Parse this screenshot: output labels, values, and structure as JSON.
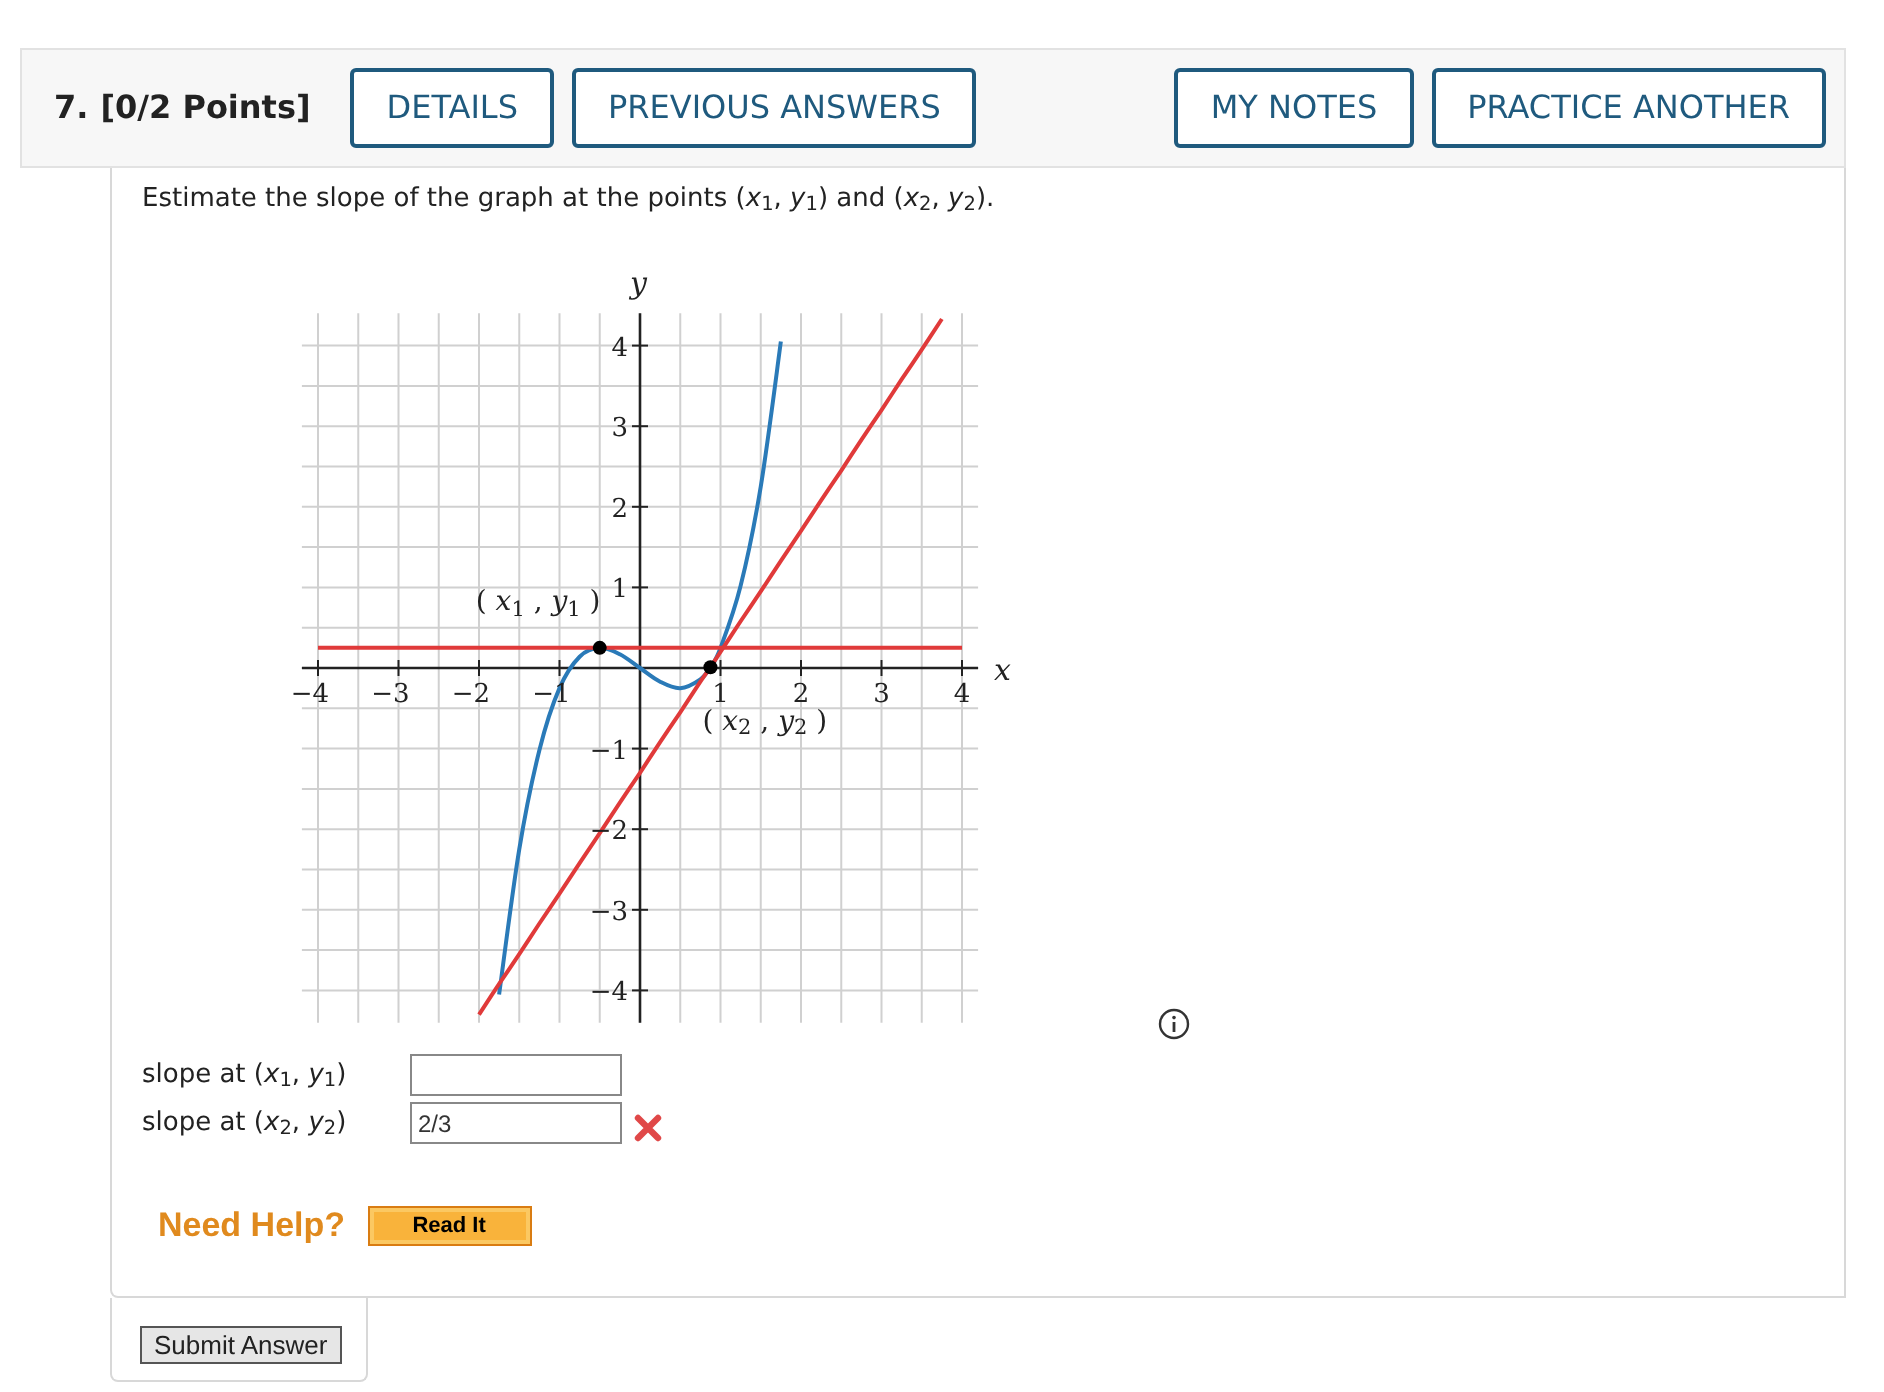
{
  "question": {
    "number": "7.",
    "points": "[0/2 Points]"
  },
  "header": {
    "left_buttons": [
      "DETAILS",
      "PREVIOUS ANSWERS"
    ],
    "right_buttons": [
      "MY NOTES",
      "PRACTICE ANOTHER"
    ]
  },
  "prompt": "Estimate the slope of the graph at the points (*x*$_{1}$, *y*$_{1}$) and (*x*$_{2}$, *y*$_{2}$).",
  "graph": {
    "point_labels": [
      "( *x*$_{1}$ , *y*$_{1}$ )",
      "( *x*$_{2}$ , *y*$_{2}$ )"
    ],
    "chart_data": {
      "type": "line",
      "xlabel": "x",
      "ylabel": "y",
      "xlim": [
        -4.2,
        4.2
      ],
      "ylim": [
        -4.4,
        4.4
      ],
      "grid": true,
      "xticks": [
        {
          "value": -4,
          "label": "−4"
        },
        {
          "value": -3,
          "label": "−3"
        },
        {
          "value": -2,
          "label": "−2"
        },
        {
          "value": -1,
          "label": "−1"
        },
        {
          "value": 1,
          "label": "1"
        },
        {
          "value": 2,
          "label": "2"
        },
        {
          "value": 3,
          "label": "3"
        },
        {
          "value": 4,
          "label": "4"
        }
      ],
      "yticks": [
        {
          "value": -4,
          "label": "−4"
        },
        {
          "value": -3,
          "label": "−3"
        },
        {
          "value": -2,
          "label": "−2"
        },
        {
          "value": -1,
          "label": "−1"
        },
        {
          "value": 1,
          "label": "1"
        },
        {
          "value": 2,
          "label": "2"
        },
        {
          "value": 3,
          "label": "3"
        },
        {
          "value": 4,
          "label": "4"
        }
      ],
      "x": [
        -4,
        -3.75,
        -3.5,
        -3.25,
        -3,
        -2.75,
        -2.5,
        -2.25,
        -2,
        -1.75,
        -1.5,
        -1.25,
        -1,
        -0.75,
        -0.5,
        -0.25,
        0,
        0.25,
        0.5,
        0.75,
        0.875,
        1,
        1.25,
        1.5,
        1.75,
        2,
        2.25,
        2.5,
        2.75,
        3,
        3.25,
        3.5,
        3.75,
        4
      ],
      "series": [
        {
          "color": "#2a7ab8",
          "values": [
            null,
            null,
            null,
            null,
            null,
            null,
            null,
            null,
            null,
            -4.05,
            -2.25,
            -1.02,
            -0.25,
            0.14,
            0.25,
            0.17,
            0,
            -0.17,
            -0.25,
            -0.14,
            0.01,
            0.25,
            1.02,
            2.25,
            4.05,
            null,
            null,
            null,
            null,
            null,
            null,
            null,
            null,
            null
          ]
        },
        {
          "color": "#e03a3a",
          "values": [
            0.25,
            0.25,
            0.25,
            0.25,
            0.25,
            0.25,
            0.25,
            0.25,
            0.25,
            0.25,
            0.25,
            0.25,
            0.25,
            0.25,
            0.25,
            0.25,
            0.25,
            0.25,
            0.25,
            0.25,
            0.25,
            0.25,
            0.25,
            0.25,
            0.25,
            0.25,
            0.25,
            0.25,
            0.25,
            0.25,
            0.25,
            0.25,
            0.25,
            0.25
          ]
        },
        {
          "color": "#e03a3a",
          "values": [
            null,
            null,
            null,
            null,
            null,
            null,
            null,
            null,
            -4.3,
            -3.92,
            -3.55,
            -3.17,
            -2.8,
            -2.42,
            -2.05,
            -1.67,
            -1.3,
            -0.92,
            -0.55,
            -0.17,
            0.01,
            0.2,
            0.58,
            0.95,
            1.33,
            1.7,
            2.08,
            2.45,
            2.83,
            3.2,
            3.58,
            3.95,
            4.33,
            null
          ]
        },
        {
          "type": "scatter",
          "color": "#000000",
          "values": [
            null,
            null,
            null,
            null,
            null,
            null,
            null,
            null,
            null,
            null,
            null,
            null,
            null,
            null,
            0.25,
            null,
            null,
            null,
            null,
            null,
            0.01,
            null,
            null,
            null,
            null,
            null,
            null,
            null,
            null,
            null,
            null,
            null,
            null,
            null
          ]
        }
      ]
    }
  },
  "answers": [
    {
      "label": "slope at (*x*$_{1}$, *y*$_{1}$)"
    },
    {
      "label": "slope at (*x*$_{2}$, *y*$_{2}$)",
      "value": "2/3",
      "correct": false
    }
  ],
  "help": {
    "title": "Need Help?",
    "buttons": [
      "Read It"
    ]
  },
  "submit": "Submit Answer"
}
